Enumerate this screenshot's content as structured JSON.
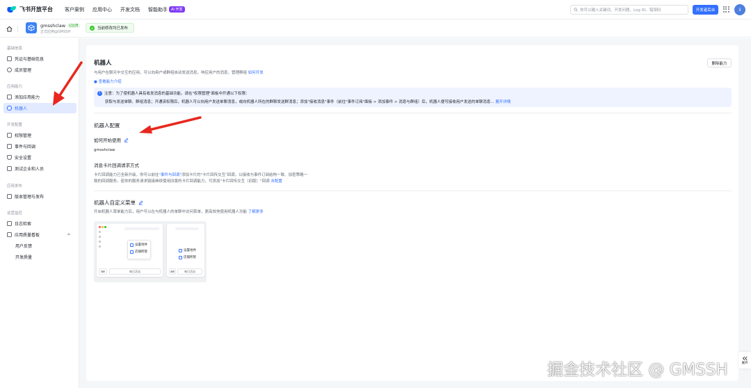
{
  "topnav": {
    "logo_text": "飞书开放平台",
    "links": [
      "客户案例",
      "应用中心",
      "开发文档",
      "智能助手"
    ],
    "ai_badge": "AI 开发",
    "search_placeholder": "你可以输入关键词、开发问题、Log ID、错误码",
    "console_button": "开发者后台",
    "avatar_text": "ii"
  },
  "appbar": {
    "app_name": "gmsshclaw",
    "app_status": "已启用",
    "app_sub": "正式应用@GMSSH",
    "publish_status": "当前修改均已发布"
  },
  "sidebar": {
    "sections": [
      {
        "title": "基础信息",
        "items": [
          "凭证与基础信息",
          "成员管理"
        ]
      },
      {
        "title": "应用能力",
        "items": [
          "添加应用能力",
          "机器人"
        ]
      },
      {
        "title": "开发配置",
        "items": [
          "权限管理",
          "事件与回调",
          "安全设置",
          "测试企业和人员"
        ]
      },
      {
        "title": "应用发布",
        "items": [
          "版本管理与发布"
        ]
      },
      {
        "title": "运营监控",
        "items": [
          "日志检索",
          "应用质量看板",
          "用户反馈",
          "开发质量"
        ]
      }
    ]
  },
  "main": {
    "title": "机器人",
    "desc": "与用户在聊天中交互的应用，可以向用户或群组自动发送消息，响应用户的消息，管理群组",
    "desc_link": "如何开发",
    "view_intro": "查看能力介绍",
    "delete_button": "删除能力",
    "notice_line1": "注意：为了使机器人具有收发消息的基础功能，请在\"权限管理\"面板中开通以下权限：",
    "notice_line2": "获取与发送单聊、群组消息；开通该权限后，机器人可以向用户发送单聊消息，或向机器人所在的群聊发送群消息；添加\"接收消息\"事件（前往\"事件订阅\"面板 > 添加事件 > 消息与群组）后，机器人便可接收用户发送的单聊消息... ",
    "notice_link": "展开详情",
    "config_title": "机器人配置",
    "how_to_label": "如何开始使用",
    "bot_name": "gmsshclaw",
    "card_cb_title": "消息卡片回调请求方式",
    "card_cb_desc1_a": "卡片回调能力已全新升级，你可以前往",
    "card_cb_desc1_link": "\"事件与回调\"",
    "card_cb_desc1_b": "添加卡片的\"卡片回传交互\"回调，以接收与事件订阅结构一致、加密策略一",
    "card_cb_desc2": "致的回调服务。若你的服务请求链接继续使用旧版的卡片回调能力，可添加\"卡片回传交互（旧版）\"回调",
    "card_cb_desc2_link": "去配置",
    "menu_title": "机器人自定义菜单",
    "menu_desc": "开启机器人菜单能力后，用户可以在与机器人的单聊中访问菜单，更高效地使用机器人功能",
    "menu_desc_link": "了解更多",
    "preview": {
      "a_items": [
        "设置地件",
        "店铺所管"
      ],
      "a_bar": "每日活动",
      "b_items": [
        "设置地件",
        "店铺所管"
      ],
      "b_bar": "每日活动"
    }
  },
  "collapse_label": "展开",
  "watermark": "掘金技术社区 @ GMSSH"
}
